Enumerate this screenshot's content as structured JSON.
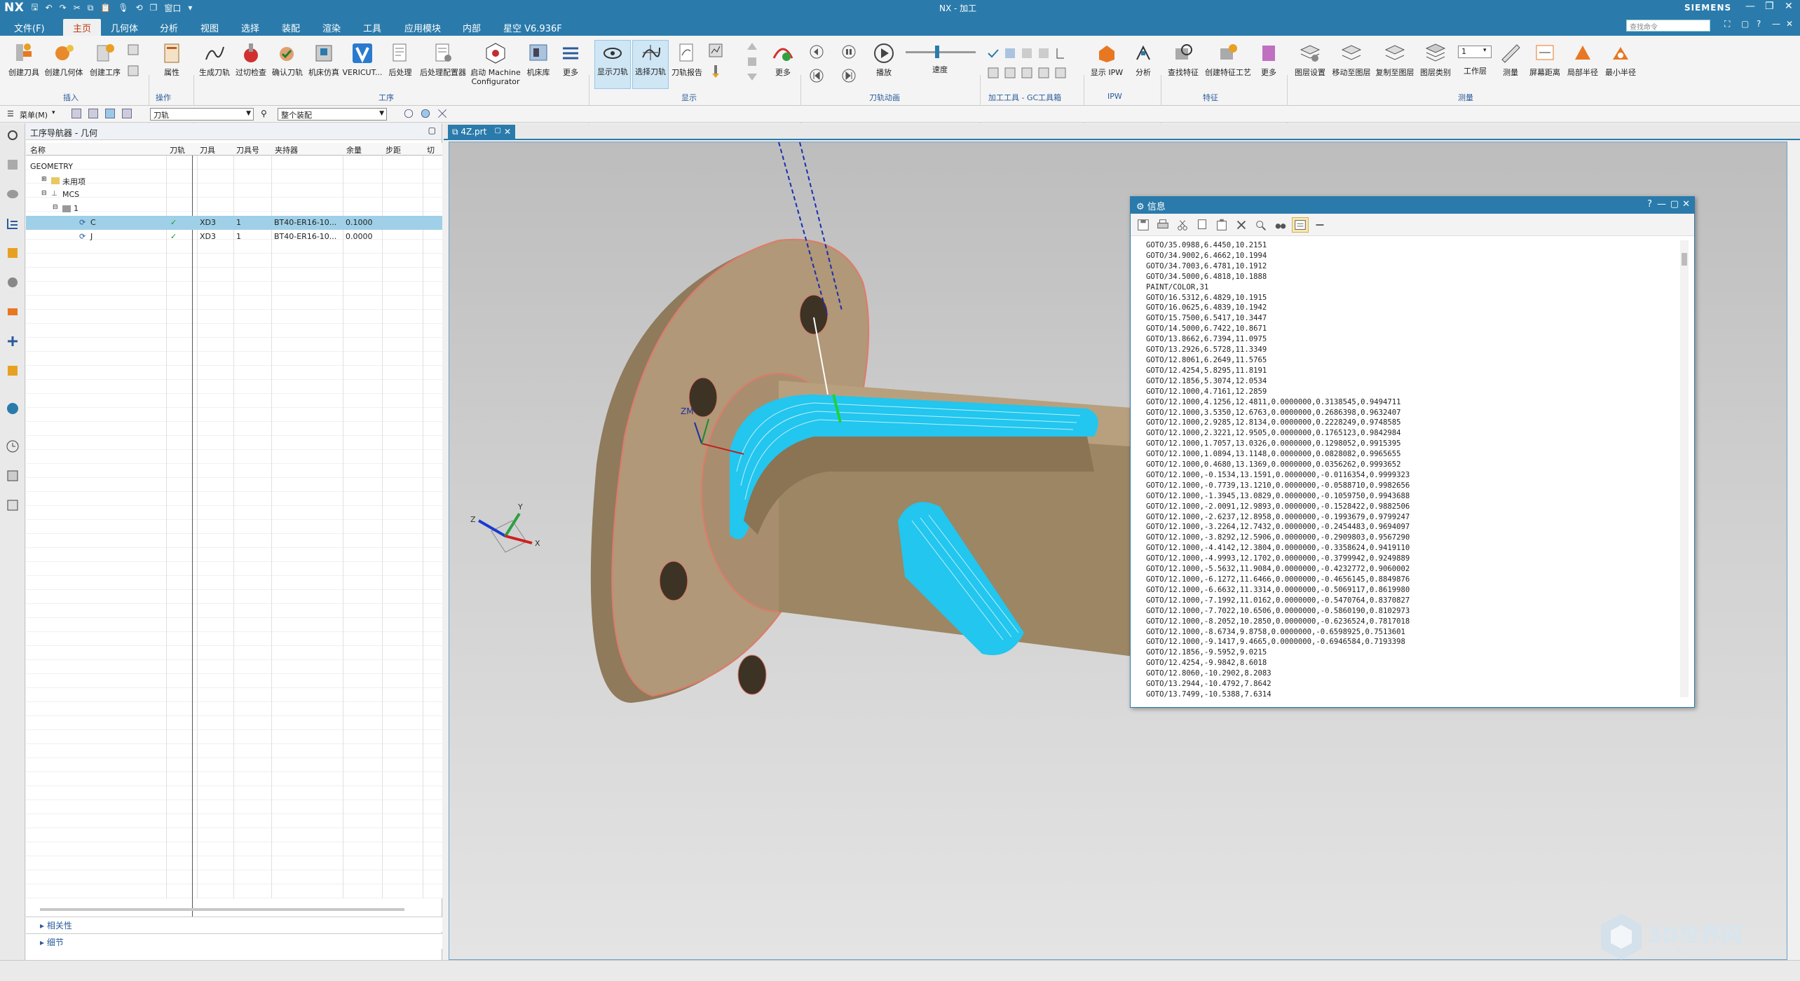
{
  "titlebar": {
    "logo": "NX",
    "title": "NX - 加工",
    "brand": "SIEMENS",
    "window_menu": "窗口"
  },
  "menu": {
    "items": [
      "文件(F)",
      "主页",
      "几何体",
      "分析",
      "视图",
      "选择",
      "装配",
      "渲染",
      "工具",
      "应用模块",
      "内部",
      "星空 V6.936F"
    ],
    "search_placeholder": "查找命令"
  },
  "ribbon": {
    "buttons": [
      "创建刀具",
      "创建几何体",
      "创建工序",
      "属性",
      "生成刀轨",
      "过切检查",
      "确认刀轨",
      "机床仿真",
      "VERICUT...",
      "后处理",
      "后处理配置器",
      "启动 Machine Configurator",
      "机床库",
      "更多",
      "显示刀轨",
      "选择刀轨",
      "刀轨报告",
      "更多",
      "播放",
      "速度",
      "显示 IPW",
      "分析",
      "查找特征",
      "创建特征工艺",
      "更多",
      "图层设置",
      "移动至图层",
      "复制至图层",
      "图层类别",
      "工作层",
      "测量",
      "屏幕距离",
      "局部半径",
      "最小半径"
    ],
    "groups": [
      "插入",
      "操作",
      "工序",
      "显示",
      "刀轨动画",
      "加工工具 - GC工具箱",
      "IPW",
      "特征",
      "测量"
    ],
    "layer_value": "1"
  },
  "toolbar2": {
    "menu_label": "菜单(M)",
    "filter_value": "刀轨",
    "assembly_value": "整个装配"
  },
  "navigator": {
    "title": "工序导航器 - 几何",
    "columns": [
      "名称",
      "刀轨",
      "刀具",
      "刀具号",
      "夹持器",
      "余量",
      "步距",
      "切"
    ],
    "tree": [
      {
        "name": "GEOMETRY",
        "toolpath": "",
        "tool": "",
        "num": "",
        "holder": "",
        "stock": ""
      },
      {
        "name": "未用项",
        "toolpath": "",
        "tool": "",
        "num": "",
        "holder": "",
        "stock": ""
      },
      {
        "name": "MCS",
        "toolpath": "",
        "tool": "",
        "num": "",
        "holder": "",
        "stock": ""
      },
      {
        "name": "1",
        "toolpath": "",
        "tool": "",
        "num": "",
        "holder": "",
        "stock": ""
      },
      {
        "name": "C",
        "toolpath": "✓",
        "tool": "XD3",
        "num": "1",
        "holder": "BT40-ER16-10...",
        "stock": "0.1000"
      },
      {
        "name": "J",
        "toolpath": "✓",
        "tool": "XD3",
        "num": "1",
        "holder": "BT40-ER16-10...",
        "stock": "0.0000"
      }
    ],
    "footer": [
      "相关性",
      "细节"
    ]
  },
  "document": {
    "tab": "4Z.prt"
  },
  "info": {
    "title": "信息",
    "lines": [
      "GOTO/35.0988,6.4450,10.2151",
      "GOTO/34.9002,6.4662,10.1994",
      "GOTO/34.7003,6.4781,10.1912",
      "GOTO/34.5000,6.4818,10.1888",
      "PAINT/COLOR,31",
      "GOTO/16.5312,6.4829,10.1915",
      "GOTO/16.0625,6.4839,10.1942",
      "GOTO/15.7500,6.5417,10.3447",
      "GOTO/14.5000,6.7422,10.8671",
      "GOTO/13.8662,6.7394,11.0975",
      "GOTO/13.2926,6.5728,11.3349",
      "GOTO/12.8061,6.2649,11.5765",
      "GOTO/12.4254,5.8295,11.8191",
      "GOTO/12.1856,5.3074,12.0534",
      "GOTO/12.1000,4.7161,12.2859",
      "GOTO/12.1000,4.1256,12.4811,0.0000000,0.3138545,0.9494711",
      "GOTO/12.1000,3.5350,12.6763,0.0000000,0.2686398,0.9632407",
      "GOTO/12.1000,2.9285,12.8134,0.0000000,0.2228249,0.9748585",
      "GOTO/12.1000,2.3221,12.9505,0.0000000,0.1765123,0.9842984",
      "GOTO/12.1000,1.7057,13.0326,0.0000000,0.1298052,0.9915395",
      "GOTO/12.1000,1.0894,13.1148,0.0000000,0.0828082,0.9965655",
      "GOTO/12.1000,0.4680,13.1369,0.0000000,0.0356262,0.9993652",
      "GOTO/12.1000,-0.1534,13.1591,0.0000000,-0.0116354,0.9999323",
      "GOTO/12.1000,-0.7739,13.1210,0.0000000,-0.0588710,0.9982656",
      "GOTO/12.1000,-1.3945,13.0829,0.0000000,-0.1059750,0.9943688",
      "GOTO/12.1000,-2.0091,12.9893,0.0000000,-0.1528422,0.9882506",
      "GOTO/12.1000,-2.6237,12.8958,0.0000000,-0.1993679,0.9799247",
      "GOTO/12.1000,-3.2264,12.7432,0.0000000,-0.2454483,0.9694097",
      "GOTO/12.1000,-3.8292,12.5906,0.0000000,-0.2909803,0.9567290",
      "GOTO/12.1000,-4.4142,12.3804,0.0000000,-0.3358624,0.9419110",
      "GOTO/12.1000,-4.9993,12.1702,0.0000000,-0.3799942,0.9249889",
      "GOTO/12.1000,-5.5632,11.9084,0.0000000,-0.4232772,0.9060002",
      "GOTO/12.1000,-6.1272,11.6466,0.0000000,-0.4656145,0.8849876",
      "GOTO/12.1000,-6.6632,11.3314,0.0000000,-0.5069117,0.8619980",
      "GOTO/12.1000,-7.1992,11.0162,0.0000000,-0.5470764,0.8370827",
      "GOTO/12.1000,-7.7022,10.6506,0.0000000,-0.5860190,0.8102973",
      "GOTO/12.1000,-8.2052,10.2850,0.0000000,-0.6236524,0.7817018",
      "GOTO/12.1000,-8.6734,9.8758,0.0000000,-0.6598925,0.7513601",
      "GOTO/12.1000,-9.1417,9.4665,0.0000000,-0.6946584,0.7193398",
      "GOTO/12.1856,-9.5952,9.0215",
      "GOTO/12.4254,-9.9842,8.6018",
      "GOTO/12.8060,-10.2902,8.2083",
      "GOTO/13.2944,-10.4792,7.8642",
      "GOTO/13.7499,-10.5388,7.6314"
    ]
  },
  "viewport": {
    "wcs": "ZM",
    "axis": {
      "x": "X",
      "y": "Y",
      "z": "Z"
    }
  },
  "watermark": {
    "text": "3D世界网",
    "sub": "WWW.3DSJW.COM"
  },
  "colors": {
    "accent": "#2a7bab",
    "part": "#a89070",
    "toolpath": "#22c6ee",
    "edge": "#e07a6a"
  }
}
